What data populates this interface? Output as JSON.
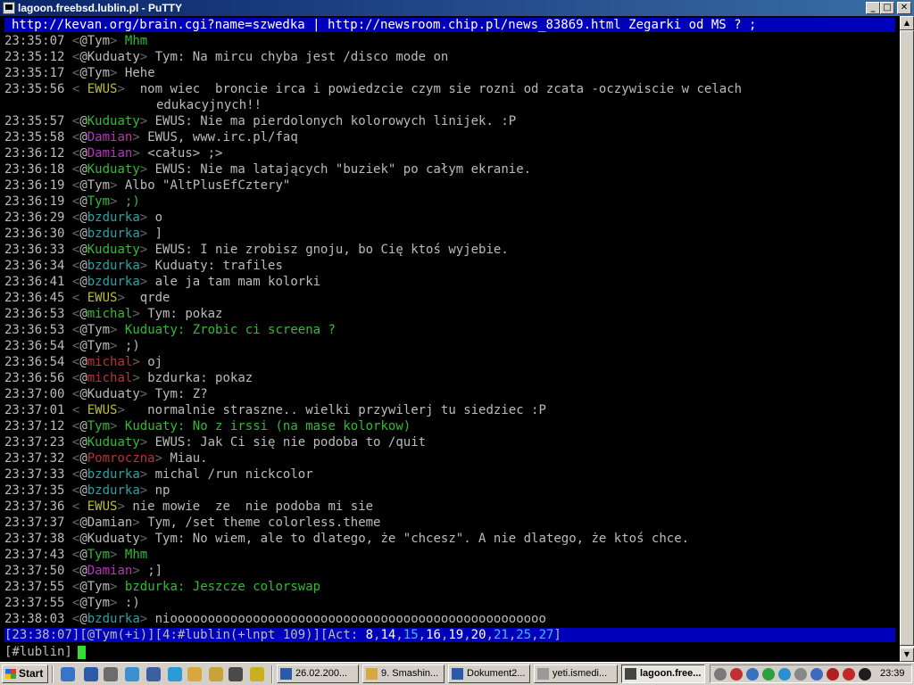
{
  "window": {
    "title": "lagoon.freebsd.lublin.pl - PuTTY",
    "min": "_",
    "max": "□",
    "close": "✕"
  },
  "topic": "http://kevan.org/brain.cgi?name=szwedka | http://newsroom.chip.pl/news_83869.html Zegarki od MS ? ;",
  "lines": [
    {
      "ts": "23:35:07",
      "prefix": "<",
      "mode": "@",
      "nick": "Tym",
      "nick_color": "default",
      "text": "Mhm",
      "text_color": "green"
    },
    {
      "ts": "23:35:12",
      "prefix": "<",
      "mode": "@",
      "nick": "Kuduaty",
      "nick_color": "default",
      "text": "Tym: Na mircu chyba jest /disco mode on",
      "text_color": "default"
    },
    {
      "ts": "23:35:17",
      "prefix": "<",
      "mode": "@",
      "nick": "Tym",
      "nick_color": "default",
      "text": "Hehe",
      "text_color": "default"
    },
    {
      "ts": "23:35:56",
      "prefix": "<",
      "mode": " ",
      "nick": "EWUS",
      "nick_color": "yellow",
      "text": " nom wiec  broncie irca i powiedzcie czym sie rozni od zcata -oczywiscie w celach",
      "text_color": "default"
    },
    {
      "cont": "edukacyjnych!!"
    },
    {
      "ts": "23:35:57",
      "prefix": "<",
      "mode": "@",
      "nick": "Kuduaty",
      "nick_color": "green",
      "text": "EWUS: Nie ma pierdolonych kolorowych linijek. :P",
      "text_color": "default"
    },
    {
      "ts": "23:35:58",
      "prefix": "<",
      "mode": "@",
      "nick": "Damian",
      "nick_color": "magenta",
      "text": "EWUS, www.irc.pl/faq",
      "text_color": "default"
    },
    {
      "ts": "23:36:12",
      "prefix": "<",
      "mode": "@",
      "nick": "Damian",
      "nick_color": "magenta",
      "text": "<całus> ;>",
      "text_color": "default"
    },
    {
      "ts": "23:36:18",
      "prefix": "<",
      "mode": "@",
      "nick": "Kuduaty",
      "nick_color": "green",
      "text": "EWUS: Nie ma latających \"buziek\" po całym ekranie.",
      "text_color": "default"
    },
    {
      "ts": "23:36:19",
      "prefix": "<",
      "mode": "@",
      "nick": "Tym",
      "nick_color": "default",
      "text": "Albo \"AltPlusEfCztery\"",
      "text_color": "default"
    },
    {
      "ts": "23:36:19",
      "prefix": "<",
      "mode": "@",
      "nick": "Tym",
      "nick_color": "green",
      "text": ";)",
      "text_color": "green"
    },
    {
      "ts": "23:36:29",
      "prefix": "<",
      "mode": "@",
      "nick": "bzdurka",
      "nick_color": "cyan",
      "text": "o",
      "text_color": "default"
    },
    {
      "ts": "23:36:30",
      "prefix": "<",
      "mode": "@",
      "nick": "bzdurka",
      "nick_color": "cyan",
      "text": "]",
      "text_color": "default"
    },
    {
      "ts": "23:36:33",
      "prefix": "<",
      "mode": "@",
      "nick": "Kuduaty",
      "nick_color": "green",
      "text": "EWUS: I nie zrobisz gnoju, bo Cię ktoś wyjebie.",
      "text_color": "default"
    },
    {
      "ts": "23:36:34",
      "prefix": "<",
      "mode": "@",
      "nick": "bzdurka",
      "nick_color": "cyan",
      "text": "Kuduaty: trafiles",
      "text_color": "default"
    },
    {
      "ts": "23:36:41",
      "prefix": "<",
      "mode": "@",
      "nick": "bzdurka",
      "nick_color": "cyan",
      "text": "ale ja tam mam kolorki",
      "text_color": "default"
    },
    {
      "ts": "23:36:45",
      "prefix": "<",
      "mode": " ",
      "nick": "EWUS",
      "nick_color": "yellow",
      "text": " qrde",
      "text_color": "default"
    },
    {
      "ts": "23:36:53",
      "prefix": "<",
      "mode": "@",
      "nick": "michal",
      "nick_color": "green",
      "text": "Tym: pokaz",
      "text_color": "default"
    },
    {
      "ts": "23:36:53",
      "prefix": "<",
      "mode": "@",
      "nick": "Tym",
      "nick_color": "default",
      "text": "Kuduaty: Zrobic ci screena ?",
      "text_color": "green"
    },
    {
      "ts": "23:36:54",
      "prefix": "<",
      "mode": "@",
      "nick": "Tym",
      "nick_color": "default",
      "text": ";)",
      "text_color": "default"
    },
    {
      "ts": "23:36:54",
      "prefix": "<",
      "mode": "@",
      "nick": "michal",
      "nick_color": "red",
      "text": "oj",
      "text_color": "default"
    },
    {
      "ts": "23:36:56",
      "prefix": "<",
      "mode": "@",
      "nick": "michal",
      "nick_color": "red",
      "text": "bzdurka: pokaz",
      "text_color": "default"
    },
    {
      "ts": "23:37:00",
      "prefix": "<",
      "mode": "@",
      "nick": "Kuduaty",
      "nick_color": "default",
      "text": "Tym: Z?",
      "text_color": "default"
    },
    {
      "ts": "23:37:01",
      "prefix": "<",
      "mode": " ",
      "nick": "EWUS",
      "nick_color": "yellow",
      "text": "  normalnie straszne.. wielki przywilerj tu siedziec :P",
      "text_color": "default"
    },
    {
      "ts": "23:37:12",
      "prefix": "<",
      "mode": "@",
      "nick": "Tym",
      "nick_color": "green",
      "text": "Kuduaty: No z irssi (na mase kolorkow)",
      "text_color": "green"
    },
    {
      "ts": "23:37:23",
      "prefix": "<",
      "mode": "@",
      "nick": "Kuduaty",
      "nick_color": "green",
      "text": "EWUS: Jak Ci się nie podoba to /quit",
      "text_color": "default"
    },
    {
      "ts": "23:37:32",
      "prefix": "<",
      "mode": "@",
      "nick": "Pomroczna",
      "nick_color": "red",
      "text": "Miau.",
      "text_color": "default"
    },
    {
      "ts": "23:37:33",
      "prefix": "<",
      "mode": "@",
      "nick": "bzdurka",
      "nick_color": "cyan",
      "text": "michal /run nickcolor",
      "text_color": "default"
    },
    {
      "ts": "23:37:35",
      "prefix": "<",
      "mode": "@",
      "nick": "bzdurka",
      "nick_color": "cyan",
      "text": "np",
      "text_color": "default"
    },
    {
      "ts": "23:37:36",
      "prefix": "<",
      "mode": " ",
      "nick": "EWUS",
      "nick_color": "yellow",
      "text": "nie mowie  ze  nie podoba mi sie",
      "text_color": "default"
    },
    {
      "ts": "23:37:37",
      "prefix": "<",
      "mode": "@",
      "nick": "Damian",
      "nick_color": "default",
      "text": "Tym, /set theme colorless.theme",
      "text_color": "default"
    },
    {
      "ts": "23:37:38",
      "prefix": "<",
      "mode": "@",
      "nick": "Kuduaty",
      "nick_color": "default",
      "text": "Tym: No wiem, ale to dlatego, że \"chcesz\". A nie dlatego, że ktoś chce.",
      "text_color": "default"
    },
    {
      "ts": "23:37:43",
      "prefix": "<",
      "mode": "@",
      "nick": "Tym",
      "nick_color": "green",
      "text": "Mhm",
      "text_color": "green"
    },
    {
      "ts": "23:37:50",
      "prefix": "<",
      "mode": "@",
      "nick": "Damian",
      "nick_color": "magenta",
      "text": ";]",
      "text_color": "default"
    },
    {
      "ts": "23:37:55",
      "prefix": "<",
      "mode": "@",
      "nick": "Tym",
      "nick_color": "default",
      "text": "bzdurka: Jeszcze colorswap",
      "text_color": "green"
    },
    {
      "ts": "23:37:55",
      "prefix": "<",
      "mode": "@",
      "nick": "Tym",
      "nick_color": "default",
      "text": ":)",
      "text_color": "default"
    },
    {
      "ts": "23:38:03",
      "prefix": "<",
      "mode": "@",
      "nick": "bzdurka",
      "nick_color": "cyan",
      "text": "nioooooooooooooooooooooooooooooooooooooooooooooooooo",
      "text_color": "default"
    }
  ],
  "status": {
    "time": "[23:38:07]",
    "user": "[@Tym(+i)]",
    "window": "[4:#lublin(+lnpt 109)]",
    "act_label": "[Act: ",
    "act": [
      {
        "n": "8",
        "c": "white"
      },
      {
        "n": "14",
        "c": "white"
      },
      {
        "n": "15",
        "c": "cyan"
      },
      {
        "n": "16",
        "c": "white"
      },
      {
        "n": "19",
        "c": "white"
      },
      {
        "n": "20",
        "c": "white"
      },
      {
        "n": "21",
        "c": "cyan"
      },
      {
        "n": "25",
        "c": "cyan"
      },
      {
        "n": "27",
        "c": "cyan"
      }
    ],
    "act_end": "]"
  },
  "input_prompt": "[#lublin]",
  "taskbar": {
    "start": "Start",
    "tasks": [
      {
        "label": "26.02.200...",
        "active": false
      },
      {
        "label": "9. Smashin...",
        "active": false
      },
      {
        "label": "Dokument2...",
        "active": false
      },
      {
        "label": "yeti.ismedi...",
        "active": false
      },
      {
        "label": "lagoon.free...",
        "active": true
      }
    ],
    "clock": "23:39"
  }
}
